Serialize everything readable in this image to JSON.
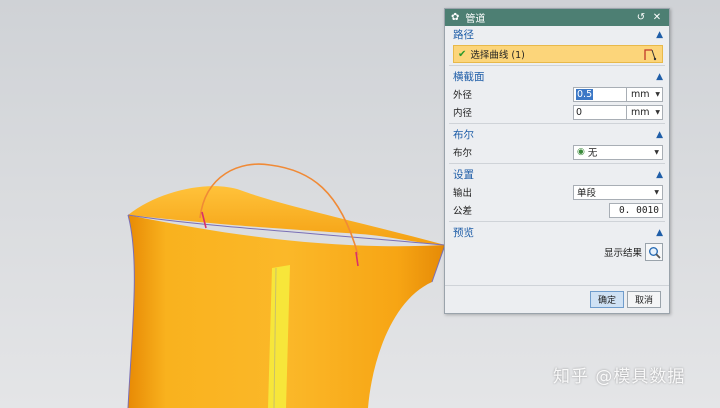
{
  "dialog": {
    "title": "管道",
    "sections": {
      "path": {
        "header": "路径",
        "select_curve_label": "选择曲线 (1)"
      },
      "cross_section": {
        "header": "横截面",
        "outer_label": "外径",
        "outer_value": "0.5",
        "outer_unit": "mm",
        "inner_label": "内径",
        "inner_value": "0",
        "inner_unit": "mm"
      },
      "boolean": {
        "header": "布尔",
        "label": "布尔",
        "value": "无"
      },
      "settings": {
        "header": "设置",
        "output_label": "输出",
        "output_value": "单段",
        "tolerance_label": "公差",
        "tolerance_value": "0. 0010"
      },
      "preview": {
        "header": "预览",
        "show_result_label": "显示结果"
      }
    },
    "buttons": {
      "ok": "确定",
      "cancel": "取消"
    }
  },
  "watermark": "知乎 @模具数据",
  "colors": {
    "titlebar": "#4d7f73",
    "section_header": "#1f5ea8",
    "selection_highlight": "#fcd57a",
    "model_orange": "#f5a623"
  }
}
